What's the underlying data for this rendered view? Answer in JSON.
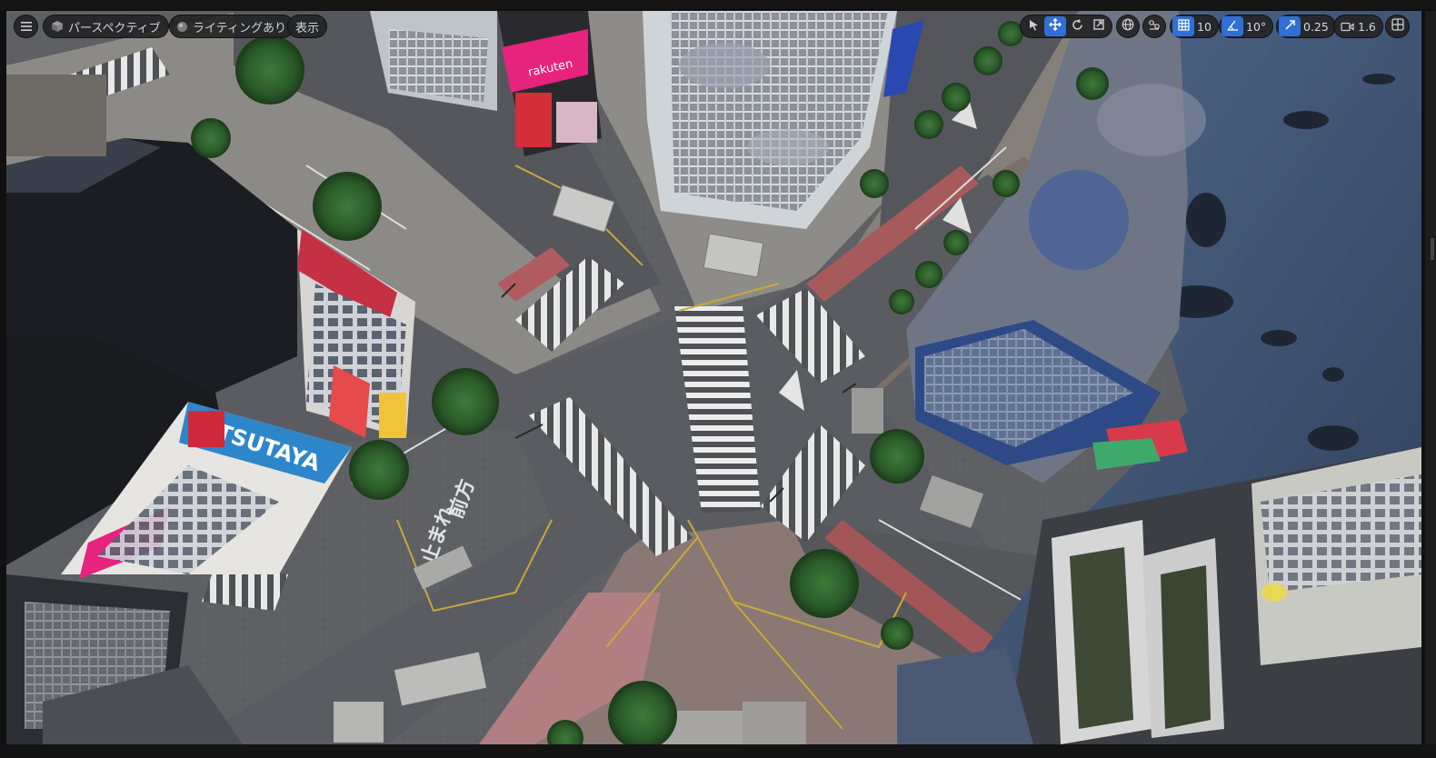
{
  "viewport": {
    "menu_icon": "hamburger-icon",
    "view_mode": {
      "label": "パースペクティブ",
      "icon": "perspective-cube-icon"
    },
    "lighting_mode": {
      "label": "ライティングあり",
      "icon": "lit-sphere-icon"
    },
    "show_menu": {
      "label": "表示"
    }
  },
  "transform_toolbar": {
    "tools": [
      {
        "name": "select",
        "icon": "select-arrow-icon",
        "active": false
      },
      {
        "name": "translate",
        "icon": "translate-move-icon",
        "active": true
      },
      {
        "name": "rotate",
        "icon": "rotate-icon",
        "active": false
      },
      {
        "name": "scale",
        "icon": "scale-icon",
        "active": false
      }
    ],
    "coordinate_space_icon": "world-globe-icon",
    "surface_snap_icon": "surface-snap-icon",
    "grid_snap": {
      "value": "10",
      "icon": "grid-snap-icon",
      "active": true
    },
    "rotation_snap": {
      "value": "10°",
      "icon": "angle-snap-icon",
      "active": true
    },
    "scale_snap": {
      "value": "0.25",
      "icon": "scale-snap-icon",
      "active": true
    },
    "camera_speed": {
      "value": "1.6",
      "icon": "camera-icon"
    },
    "layout_icon": "viewport-layout-icon"
  },
  "scene": {
    "road_markings": [
      {
        "text": "前方",
        "icon": "road-text-mark"
      },
      {
        "text": "止まれ",
        "icon": "road-text-mark"
      }
    ],
    "billboards": [
      {
        "text": "rakuten",
        "color": "#e6237d"
      },
      {
        "text": "TSUTAYA",
        "color": "#2d86c9"
      }
    ]
  },
  "colors": {
    "accent": "#2f6fd6",
    "toolbar_bg": "#242426",
    "toolbar_text": "#d4d4d4",
    "sky": "#3f5270"
  }
}
